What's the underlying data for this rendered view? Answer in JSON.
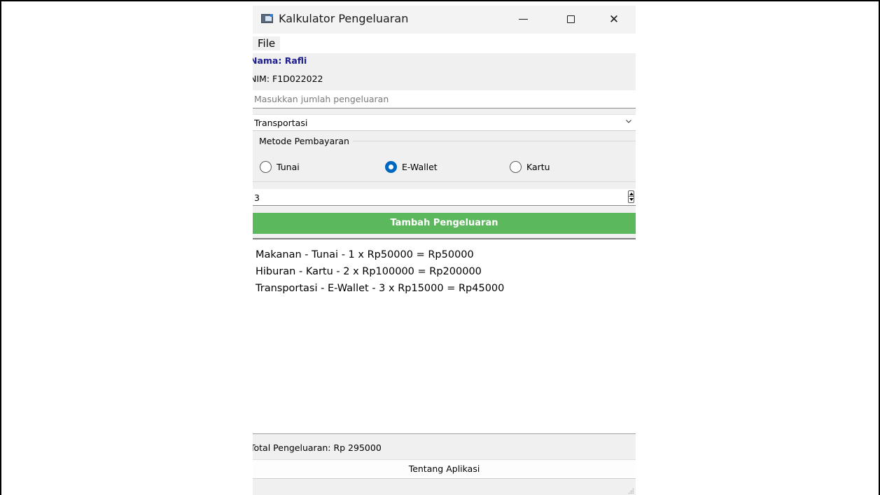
{
  "window": {
    "title": "Kalkulator Pengeluaran",
    "icon": "app-window-icon",
    "controls": {
      "minimize": "minimize-icon",
      "maximize": "maximize-icon",
      "close": "✕"
    }
  },
  "menu": {
    "file": "File"
  },
  "student": {
    "name": "Nama: Rafli",
    "nim": "NIM: F1D022022"
  },
  "amount_input": {
    "value": "",
    "placeholder": "Masukkan jumlah pengeluaran"
  },
  "category": {
    "selected": "Transportasi"
  },
  "payment": {
    "group_title": "Metode Pembayaran",
    "options": [
      {
        "label": "Tunai",
        "checked": false
      },
      {
        "label": "E-Wallet",
        "checked": true
      },
      {
        "label": "Kartu",
        "checked": false
      }
    ]
  },
  "quantity": {
    "value": "3"
  },
  "add_button": "Tambah Pengeluaran",
  "expenses": [
    "Makanan - Tunai - 1 x Rp50000 = Rp50000",
    "Hiburan - Kartu - 2 x Rp100000 = Rp200000",
    "Transportasi - E-Wallet - 3 x Rp15000 = Rp45000"
  ],
  "total": "Total Pengeluaran: Rp 295000",
  "about_button": "Tentang Aplikasi",
  "colors": {
    "add_button_bg": "#5cb85c",
    "name_label": "#1d1d8f",
    "radio_checked": "#0067c0"
  }
}
